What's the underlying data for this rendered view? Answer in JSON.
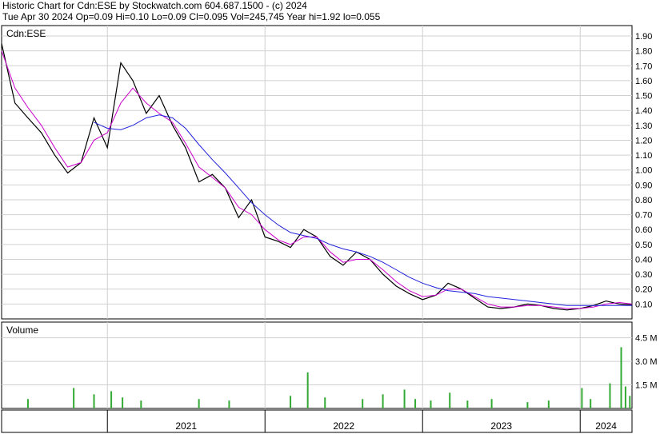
{
  "header": {
    "title": "Historic Chart for Cdn:ESE by Stockwatch.com 604.687.1500 - (c) 2024",
    "quote": "Tue Apr 30 2024  Op=0.09  Hi=0.10  Lo=0.09  Cl=0.095  Vol=245,745  Year hi=1.92  lo=0.055"
  },
  "chart_data": [
    {
      "type": "line",
      "title": "Cdn:ESE",
      "x_range": [
        "2020-05-01",
        "2024-04-30"
      ],
      "ylim": [
        0.0,
        1.97
      ],
      "y_ticks": [
        "0.10",
        "0.20",
        "0.30",
        "0.40",
        "0.50",
        "0.60",
        "0.70",
        "0.80",
        "0.90",
        "1.00",
        "1.10",
        "1.20",
        "1.30",
        "1.40",
        "1.50",
        "1.60",
        "1.70",
        "1.80",
        "1.90"
      ],
      "grid": true,
      "series": [
        {
          "color": "#000000",
          "points": [
            [
              "2020-05-01",
              1.85
            ],
            [
              "2020-06-01",
              1.45
            ],
            [
              "2020-07-01",
              1.35
            ],
            [
              "2020-08-01",
              1.25
            ],
            [
              "2020-09-01",
              1.1
            ],
            [
              "2020-10-01",
              0.98
            ],
            [
              "2020-11-01",
              1.05
            ],
            [
              "2020-12-01",
              1.35
            ],
            [
              "2021-01-01",
              1.15
            ],
            [
              "2021-02-01",
              1.72
            ],
            [
              "2021-03-01",
              1.6
            ],
            [
              "2021-04-01",
              1.38
            ],
            [
              "2021-05-01",
              1.5
            ],
            [
              "2021-06-01",
              1.3
            ],
            [
              "2021-07-01",
              1.15
            ],
            [
              "2021-08-01",
              0.92
            ],
            [
              "2021-09-01",
              0.97
            ],
            [
              "2021-10-01",
              0.88
            ],
            [
              "2021-11-01",
              0.68
            ],
            [
              "2021-12-01",
              0.8
            ],
            [
              "2022-01-01",
              0.55
            ],
            [
              "2022-02-01",
              0.52
            ],
            [
              "2022-03-01",
              0.48
            ],
            [
              "2022-04-01",
              0.6
            ],
            [
              "2022-05-01",
              0.55
            ],
            [
              "2022-06-01",
              0.42
            ],
            [
              "2022-07-01",
              0.36
            ],
            [
              "2022-08-01",
              0.45
            ],
            [
              "2022-09-01",
              0.4
            ],
            [
              "2022-10-01",
              0.3
            ],
            [
              "2022-11-01",
              0.22
            ],
            [
              "2022-12-01",
              0.17
            ],
            [
              "2023-01-01",
              0.13
            ],
            [
              "2023-02-01",
              0.16
            ],
            [
              "2023-03-01",
              0.24
            ],
            [
              "2023-04-01",
              0.2
            ],
            [
              "2023-05-01",
              0.14
            ],
            [
              "2023-06-01",
              0.08
            ],
            [
              "2023-07-01",
              0.07
            ],
            [
              "2023-08-01",
              0.08
            ],
            [
              "2023-09-01",
              0.1
            ],
            [
              "2023-10-01",
              0.09
            ],
            [
              "2023-11-01",
              0.07
            ],
            [
              "2023-12-01",
              0.06
            ],
            [
              "2024-01-01",
              0.07
            ],
            [
              "2024-02-01",
              0.09
            ],
            [
              "2024-03-01",
              0.12
            ],
            [
              "2024-04-01",
              0.1
            ],
            [
              "2024-04-30",
              0.095
            ]
          ]
        },
        {
          "color": "#cc00cc",
          "points": [
            [
              "2020-05-01",
              1.8
            ],
            [
              "2020-06-01",
              1.55
            ],
            [
              "2020-07-01",
              1.42
            ],
            [
              "2020-08-01",
              1.3
            ],
            [
              "2020-09-01",
              1.15
            ],
            [
              "2020-10-01",
              1.02
            ],
            [
              "2020-11-01",
              1.05
            ],
            [
              "2020-12-01",
              1.2
            ],
            [
              "2021-01-01",
              1.25
            ],
            [
              "2021-02-01",
              1.45
            ],
            [
              "2021-03-01",
              1.55
            ],
            [
              "2021-04-01",
              1.45
            ],
            [
              "2021-05-01",
              1.38
            ],
            [
              "2021-06-01",
              1.32
            ],
            [
              "2021-07-01",
              1.18
            ],
            [
              "2021-08-01",
              1.02
            ],
            [
              "2021-09-01",
              0.95
            ],
            [
              "2021-10-01",
              0.88
            ],
            [
              "2021-11-01",
              0.75
            ],
            [
              "2021-12-01",
              0.7
            ],
            [
              "2022-01-01",
              0.6
            ],
            [
              "2022-02-01",
              0.53
            ],
            [
              "2022-03-01",
              0.5
            ],
            [
              "2022-04-01",
              0.55
            ],
            [
              "2022-05-01",
              0.55
            ],
            [
              "2022-06-01",
              0.45
            ],
            [
              "2022-07-01",
              0.38
            ],
            [
              "2022-08-01",
              0.4
            ],
            [
              "2022-09-01",
              0.4
            ],
            [
              "2022-10-01",
              0.33
            ],
            [
              "2022-11-01",
              0.25
            ],
            [
              "2022-12-01",
              0.19
            ],
            [
              "2023-01-01",
              0.15
            ],
            [
              "2023-02-01",
              0.16
            ],
            [
              "2023-03-01",
              0.2
            ],
            [
              "2023-04-01",
              0.2
            ],
            [
              "2023-05-01",
              0.15
            ],
            [
              "2023-06-01",
              0.1
            ],
            [
              "2023-07-01",
              0.08
            ],
            [
              "2023-08-01",
              0.08
            ],
            [
              "2023-09-01",
              0.09
            ],
            [
              "2023-10-01",
              0.09
            ],
            [
              "2023-11-01",
              0.08
            ],
            [
              "2023-12-01",
              0.07
            ],
            [
              "2024-01-01",
              0.07
            ],
            [
              "2024-02-01",
              0.08
            ],
            [
              "2024-03-01",
              0.1
            ],
            [
              "2024-04-01",
              0.11
            ],
            [
              "2024-04-30",
              0.1
            ]
          ]
        },
        {
          "color": "#2222dd",
          "points": [
            [
              "2020-12-01",
              1.32
            ],
            [
              "2021-01-01",
              1.28
            ],
            [
              "2021-02-01",
              1.27
            ],
            [
              "2021-03-01",
              1.3
            ],
            [
              "2021-04-01",
              1.35
            ],
            [
              "2021-05-01",
              1.37
            ],
            [
              "2021-06-01",
              1.35
            ],
            [
              "2021-07-01",
              1.28
            ],
            [
              "2021-08-01",
              1.17
            ],
            [
              "2021-09-01",
              1.07
            ],
            [
              "2021-10-01",
              0.98
            ],
            [
              "2021-11-01",
              0.88
            ],
            [
              "2021-12-01",
              0.78
            ],
            [
              "2022-01-01",
              0.7
            ],
            [
              "2022-02-01",
              0.63
            ],
            [
              "2022-03-01",
              0.58
            ],
            [
              "2022-04-01",
              0.56
            ],
            [
              "2022-05-01",
              0.54
            ],
            [
              "2022-06-01",
              0.5
            ],
            [
              "2022-07-01",
              0.47
            ],
            [
              "2022-08-01",
              0.45
            ],
            [
              "2022-09-01",
              0.42
            ],
            [
              "2022-10-01",
              0.38
            ],
            [
              "2022-11-01",
              0.33
            ],
            [
              "2022-12-01",
              0.28
            ],
            [
              "2023-01-01",
              0.24
            ],
            [
              "2023-02-01",
              0.21
            ],
            [
              "2023-03-01",
              0.19
            ],
            [
              "2023-04-01",
              0.18
            ],
            [
              "2023-05-01",
              0.17
            ],
            [
              "2023-06-01",
              0.15
            ],
            [
              "2023-07-01",
              0.14
            ],
            [
              "2023-08-01",
              0.13
            ],
            [
              "2023-09-01",
              0.12
            ],
            [
              "2023-10-01",
              0.11
            ],
            [
              "2023-11-01",
              0.1
            ],
            [
              "2023-12-01",
              0.09
            ],
            [
              "2024-01-01",
              0.09
            ],
            [
              "2024-02-01",
              0.09
            ],
            [
              "2024-03-01",
              0.09
            ],
            [
              "2024-04-01",
              0.09
            ],
            [
              "2024-04-30",
              0.09
            ]
          ]
        }
      ]
    },
    {
      "type": "bar",
      "title": "Volume",
      "y_ticks": [
        "1.5 M",
        "3.0 M",
        "4.5 M"
      ],
      "ylim": [
        0,
        5.5
      ],
      "x_ticks": [
        "2021",
        "2022",
        "2023",
        "2024"
      ],
      "bars": [
        [
          "2020-07-01",
          0.6
        ],
        [
          "2020-10-15",
          1.3
        ],
        [
          "2020-12-01",
          0.9
        ],
        [
          "2021-01-10",
          1.1
        ],
        [
          "2021-02-05",
          0.7
        ],
        [
          "2021-03-20",
          0.5
        ],
        [
          "2021-08-01",
          0.6
        ],
        [
          "2021-10-10",
          0.5
        ],
        [
          "2022-03-01",
          0.8
        ],
        [
          "2022-04-10",
          2.3
        ],
        [
          "2022-05-20",
          0.7
        ],
        [
          "2022-08-15",
          0.6
        ],
        [
          "2022-10-01",
          0.9
        ],
        [
          "2022-11-20",
          1.2
        ],
        [
          "2022-12-15",
          0.6
        ],
        [
          "2023-01-20",
          0.5
        ],
        [
          "2023-03-05",
          1.0
        ],
        [
          "2023-04-15",
          0.5
        ],
        [
          "2023-06-10",
          0.6
        ],
        [
          "2023-09-01",
          0.4
        ],
        [
          "2023-10-20",
          0.5
        ],
        [
          "2024-01-05",
          1.3
        ],
        [
          "2024-01-25",
          0.6
        ],
        [
          "2024-03-10",
          1.6
        ],
        [
          "2024-04-05",
          3.9
        ],
        [
          "2024-04-15",
          1.4
        ],
        [
          "2024-04-25",
          0.8
        ]
      ]
    }
  ]
}
